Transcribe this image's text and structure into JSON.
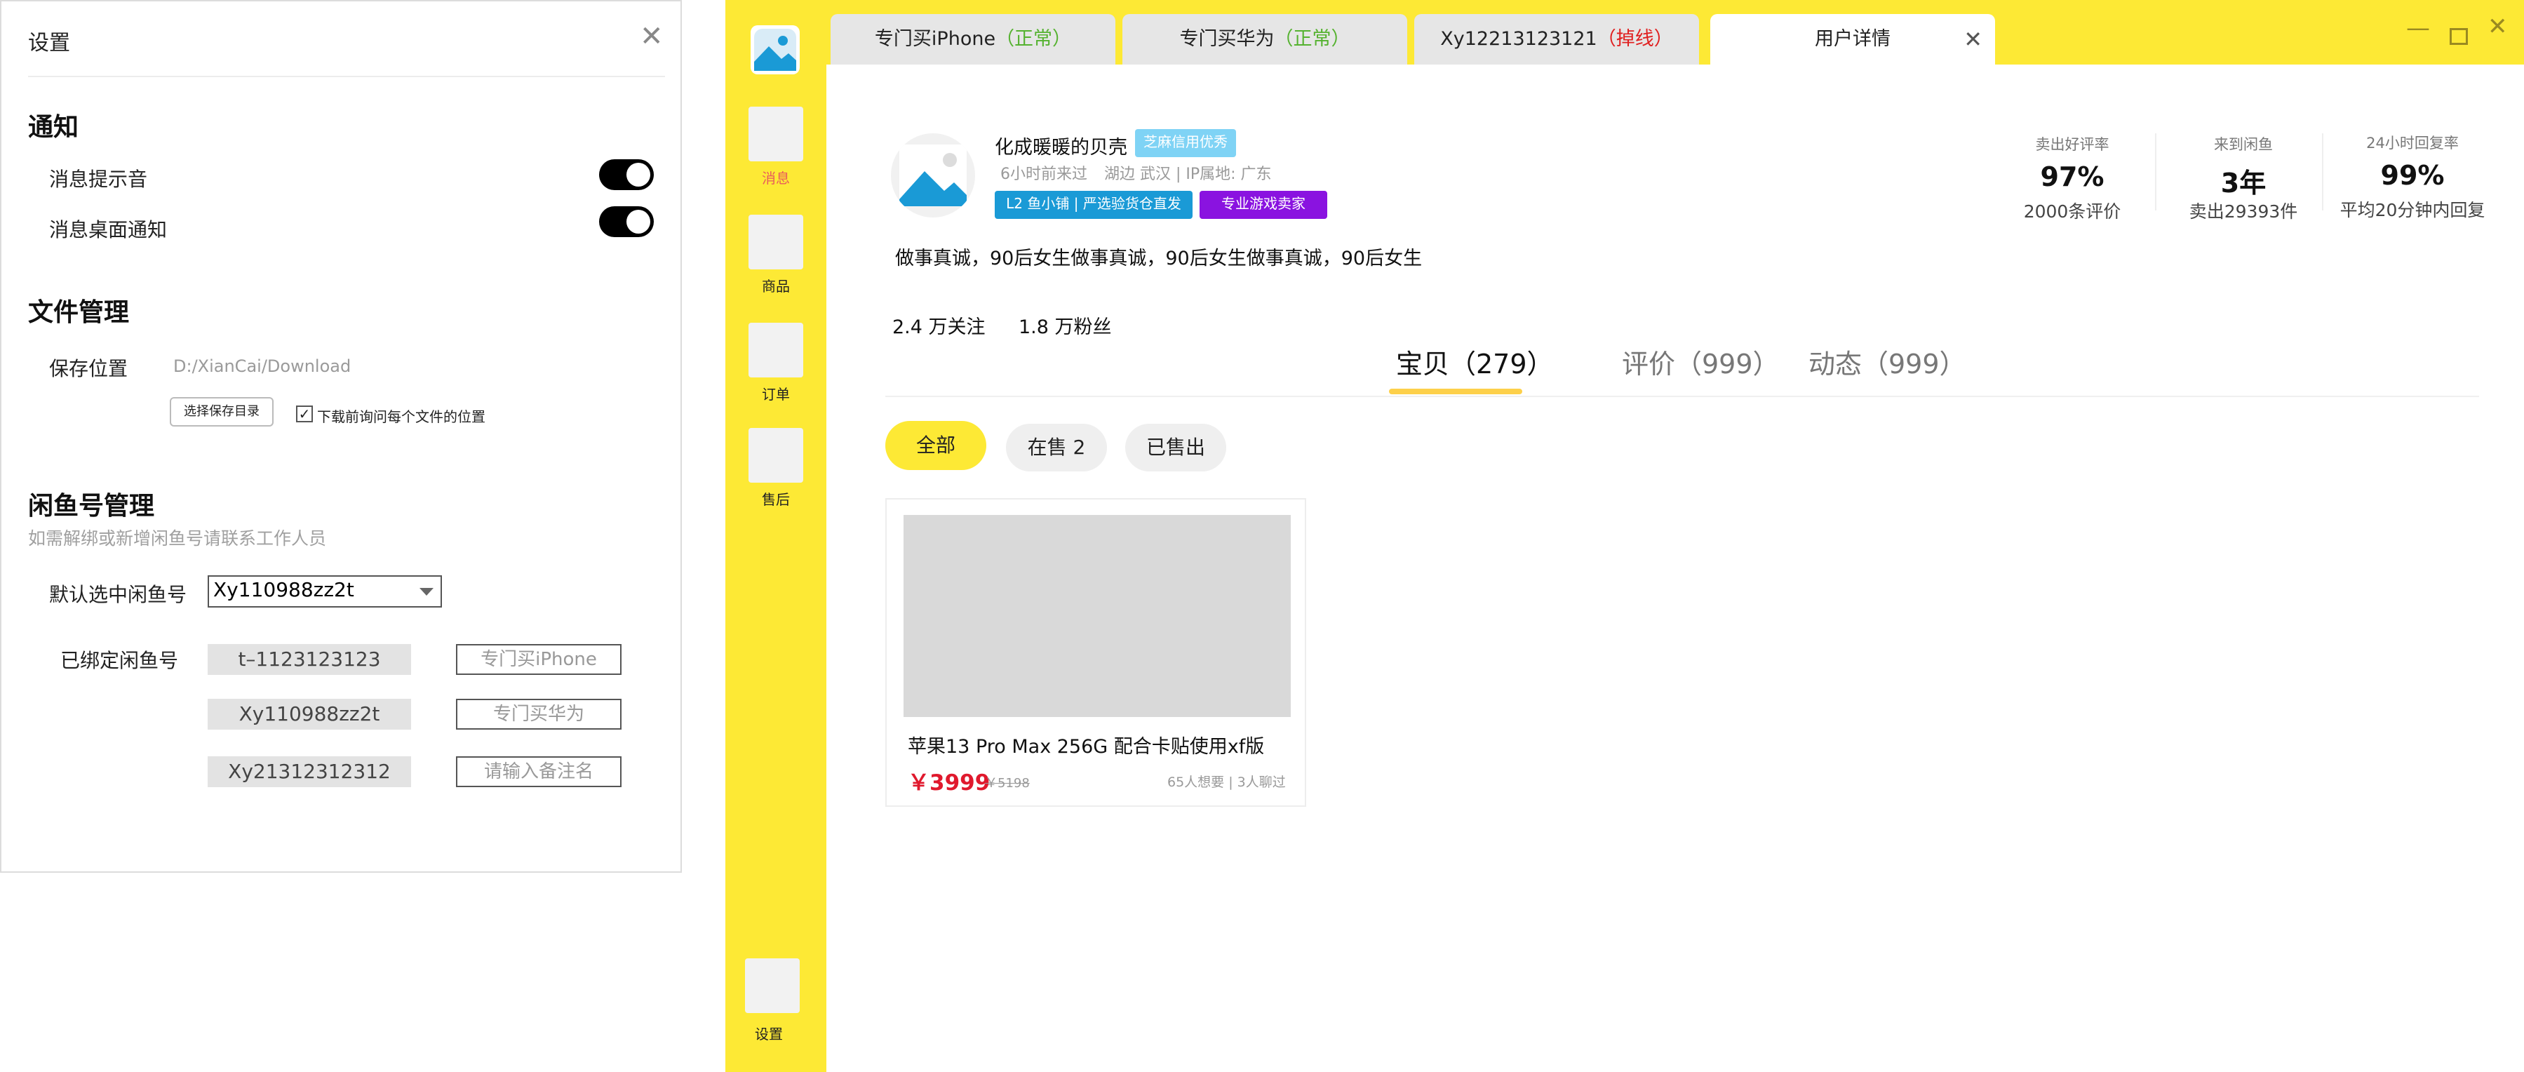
{
  "settings": {
    "title": "设置",
    "notify": {
      "heading": "通知",
      "sound_label": "消息提示音",
      "desktop_label": "消息桌面通知"
    },
    "files": {
      "heading": "文件管理",
      "save_location_label": "保存位置",
      "save_path": "D:/XianCai/Download",
      "choose_dir_button": "选择保存目录",
      "ask_each_time_label": "下载前询问每个文件的位置"
    },
    "accounts": {
      "heading": "闲鱼号管理",
      "hint": "如需解绑或新增闲鱼号请联系工作人员",
      "default_label": "默认选中闲鱼号",
      "default_value": "Xy110988zz2t",
      "bound_label": "已绑定闲鱼号",
      "bound": [
        {
          "id": "t–1123123123",
          "remark": "专门买iPhone"
        },
        {
          "id": "Xy110988zz2t",
          "remark": "专门买华为"
        },
        {
          "id": "Xy21312312312",
          "remark": "",
          "remark_placeholder": "请输入备注名"
        }
      ]
    }
  },
  "sidebar": {
    "items": [
      {
        "label": "消息",
        "color": "#e85c5c"
      },
      {
        "label": "商品",
        "color": "#222222"
      },
      {
        "label": "订单",
        "color": "#222222"
      },
      {
        "label": "售后",
        "color": "#222222"
      }
    ],
    "settings_label": "设置"
  },
  "tabs": [
    {
      "name": "专门买iPhone",
      "status": "（正常）",
      "status_color": "#55b230"
    },
    {
      "name": "专门买华为",
      "status": "（正常）",
      "status_color": "#55b230"
    },
    {
      "name": "Xy12213123121",
      "status": "（掉线）",
      "status_color": "#e02020"
    },
    {
      "name": "用户详情",
      "status": "",
      "status_color": "#222222"
    }
  ],
  "profile": {
    "name": "化成暖暖的贝壳",
    "credit_badge": "芝麻信用优秀",
    "last_seen": "6小时前来过",
    "location": "湖边 武汉 | IP属地: 广东",
    "shop_badge": "L2 鱼小铺 | 严选验货仓直发",
    "seller_badge": "专业游戏卖家",
    "bio": "做事真诚，90后女生做事真诚，90后女生做事真诚，90后女生",
    "follows": "2.4 万关注",
    "fans": "1.8 万粉丝"
  },
  "stats": [
    {
      "label": "卖出好评率",
      "value": "97%",
      "sub": "2000条评价"
    },
    {
      "label": "来到闲鱼",
      "value": "3年",
      "sub": "卖出29393件"
    },
    {
      "label": "24小时回复率",
      "value": "99%",
      "sub": "平均20分钟内回复"
    }
  ],
  "content_tabs": [
    "宝贝（279）",
    "评价（999）",
    "动态（999）"
  ],
  "filters": [
    "全部",
    "在售 2",
    "已售出"
  ],
  "product": {
    "title": "苹果13 Pro Max 256G  配合卡贴使用xf版",
    "price": "￥3999",
    "orig_price": "￥5198",
    "meta": "65人想要 | 3人聊过"
  },
  "colors": {
    "brand_yellow": "#fde935",
    "credit_badge": "#7fd3f5",
    "shop_badge": "#1a9ad6",
    "seller_badge": "#8a13e0",
    "price_red": "#e0192d",
    "ok_green": "#55b230",
    "offline_red": "#e02020"
  }
}
